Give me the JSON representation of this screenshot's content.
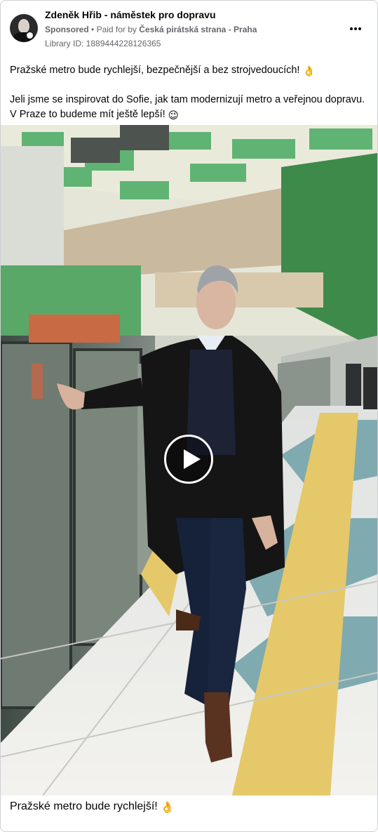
{
  "post": {
    "author_name": "Zdeněk Hřib - náměstek pro dopravu",
    "sponsored_label": "Sponsored",
    "separator": "•",
    "paid_prefix": "Paid for by",
    "paid_by": "Česká pirátská strana - Praha",
    "library_id": "Library ID: 1889444228126365",
    "text_line1": "Pražské metro bude rychlejší, bezpečnější a bez strojvedoucích!",
    "text_line1_emoji": "👌",
    "text_line2": "Jeli jsme se inspirovat do Sofie, jak tam modernizují metro a veřejnou dopravu. V Praze to budeme mít ještě lepší!",
    "text_line2_emoji": "😉",
    "caption": "Pražské metro bude rychlejší!",
    "caption_emoji": "👌"
  },
  "icons": {
    "more": "more-options-icon",
    "play": "play-icon",
    "avatar": "profile-picture"
  },
  "colors": {
    "secondary_text": "#65676b",
    "primary_text": "#050505",
    "border": "#ced0d4",
    "floor_yellow": "#e5c86a",
    "floor_teal": "#7faab0",
    "ceiling_green": "#5fb474"
  }
}
